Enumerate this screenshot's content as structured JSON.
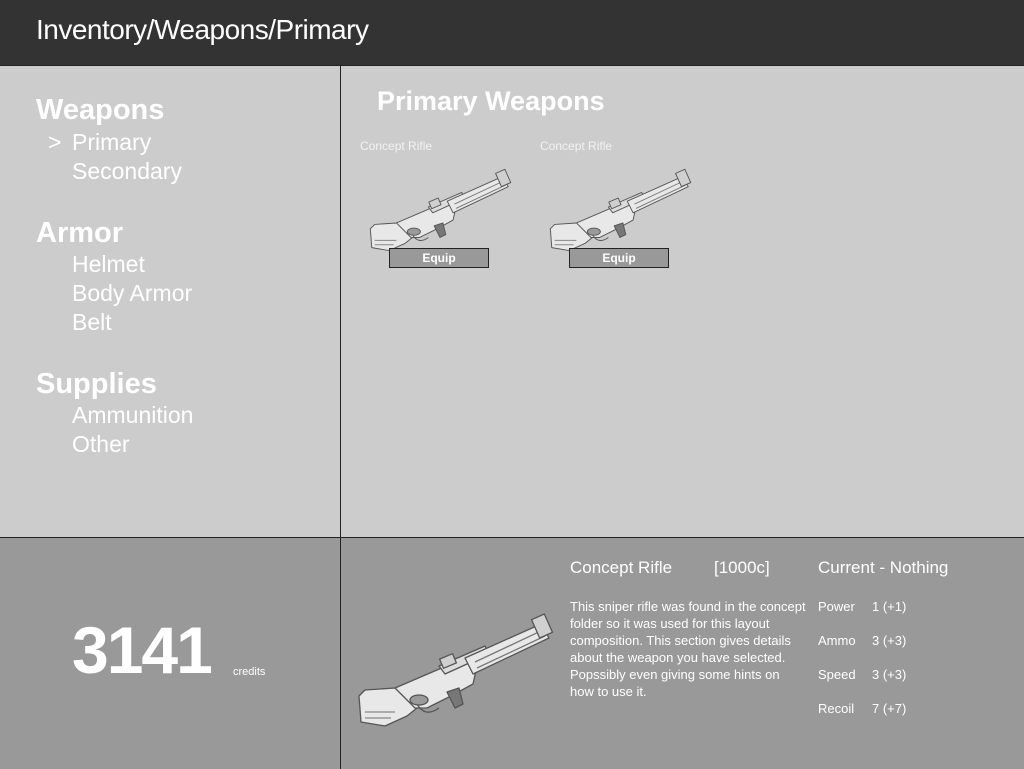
{
  "header": {
    "breadcrumb": "Inventory/Weapons/Primary"
  },
  "sidebar": {
    "selected_marker": ">",
    "categories": [
      {
        "heading": "Weapons",
        "items": [
          "Primary",
          "Secondary"
        ]
      },
      {
        "heading": "Armor",
        "items": [
          "Helmet",
          "Body Armor",
          "Belt"
        ]
      },
      {
        "heading": "Supplies",
        "items": [
          "Ammunition",
          "Other"
        ]
      }
    ],
    "selected_item": "Primary"
  },
  "main": {
    "title": "Primary Weapons",
    "cards": [
      {
        "name": "Concept Rifle",
        "button": "Equip",
        "icon": "sniper-rifle-icon"
      },
      {
        "name": "Concept Rifle",
        "button": "Equip",
        "icon": "sniper-rifle-icon"
      }
    ]
  },
  "wallet": {
    "amount": "3141",
    "unit": "credits"
  },
  "details": {
    "name": "Concept Rifle",
    "price": "[1000c]",
    "current": "Current  - Nothing",
    "description": "This sniper rifle was found in the concept folder so it was used for this layout composition. This section gives details about the weapon you have selected. Popssibly even giving some hints on how to use it.",
    "stats": [
      {
        "name": "Power",
        "value": "1 (+1)"
      },
      {
        "name": "Ammo",
        "value": "3 (+3)"
      },
      {
        "name": "Speed",
        "value": "3 (+3)"
      },
      {
        "name": "Recoil",
        "value": "7 (+7)"
      }
    ]
  },
  "colors": {
    "header_bg": "#333333",
    "panel_light": "#cccccc",
    "panel_dark": "#999999",
    "text": "#ffffff"
  }
}
